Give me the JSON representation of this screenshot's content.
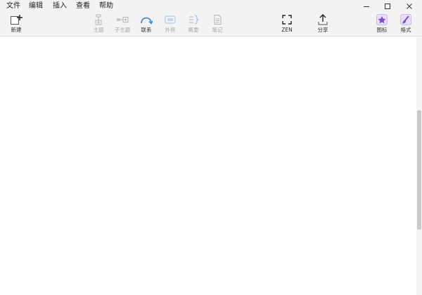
{
  "menu": {
    "file": "文件",
    "edit": "编辑",
    "insert": "插入",
    "view": "查看",
    "help": "帮助"
  },
  "toolbar": {
    "new": "新建",
    "topic": "主题",
    "subtopic": "子主题",
    "relationship": "联系",
    "boundary": "外框",
    "summary": "概要",
    "note": "笔记",
    "zen": "ZEN",
    "share": "分享",
    "icon": "图标",
    "format": "格式"
  },
  "icons": {
    "new": "new-document-plus-icon",
    "topic": "topic-icon",
    "subtopic": "subtopic-icon",
    "relationship": "relationship-arc-icon",
    "boundary": "boundary-frame-icon",
    "summary": "summary-brace-icon",
    "note": "note-icon",
    "zen": "fullscreen-corners-icon",
    "share": "share-upload-arrow-icon",
    "icon": "star-badge-icon",
    "format": "paint-brush-icon"
  },
  "colors": {
    "accent_blue": "#3b8de0",
    "icon_purple": "#7b4bd8",
    "icon_purple_bg": "#e9ddf9",
    "disabled": "#a8a8a8",
    "toolbar_bg": "#f3f3f3"
  },
  "states": {
    "topic_enabled": false,
    "subtopic_enabled": false,
    "relationship_enabled": true,
    "boundary_enabled": false,
    "summary_enabled": false,
    "note_enabled": false
  }
}
